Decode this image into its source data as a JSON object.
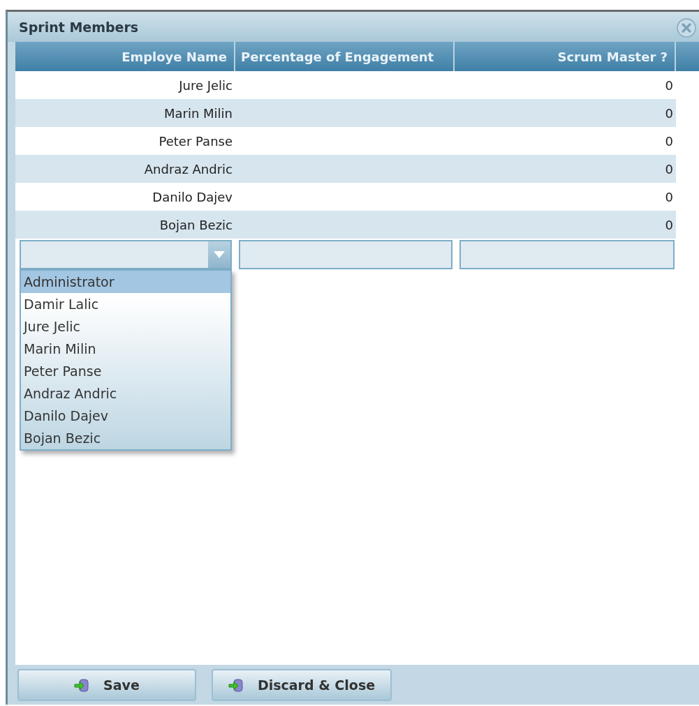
{
  "window": {
    "title": "Sprint Members"
  },
  "table": {
    "columns": [
      "Employe Name",
      "Percentage of Engagement",
      "Scrum Master ?"
    ],
    "rows": [
      {
        "employee": "Jure Jelic",
        "scrum_master": "0"
      },
      {
        "employee": "Marin Milin",
        "scrum_master": "0"
      },
      {
        "employee": "Peter Panse",
        "scrum_master": "0"
      },
      {
        "employee": "Andraz Andric",
        "scrum_master": "0"
      },
      {
        "employee": "Danilo Dajev",
        "scrum_master": "0"
      },
      {
        "employee": "Bojan Bezic",
        "scrum_master": "0"
      }
    ]
  },
  "dropdown": {
    "items": [
      {
        "label": "Administrator",
        "selected": true
      },
      {
        "label": "Damir Lalic",
        "selected": false
      },
      {
        "label": "Jure Jelic",
        "selected": false
      },
      {
        "label": "Marin Milin",
        "selected": false
      },
      {
        "label": "Peter Panse",
        "selected": false
      },
      {
        "label": "Andraz Andric",
        "selected": false
      },
      {
        "label": "Danilo Dajev",
        "selected": false
      },
      {
        "label": "Bojan Bezic",
        "selected": false
      }
    ]
  },
  "buttons": [
    "Save",
    "Discard & Close"
  ]
}
